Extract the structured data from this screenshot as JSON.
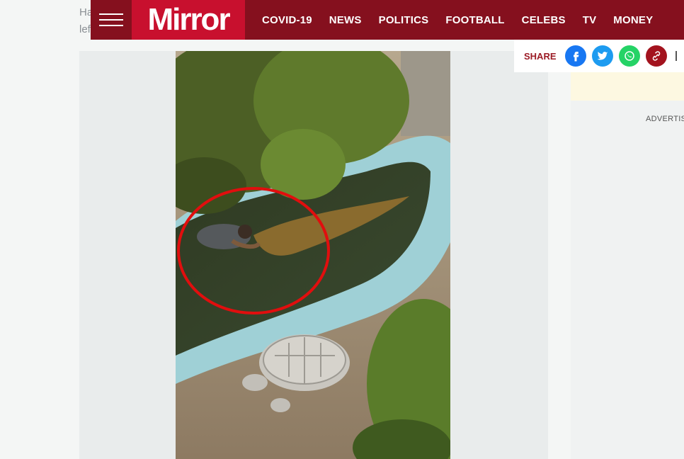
{
  "page": {
    "background_text_line1": "Ha",
    "background_text_line2": "lef"
  },
  "header": {
    "brand": "Mirror",
    "brand_color": "#c8102e",
    "nav_color": "#85101e",
    "nav": [
      "COVID-19",
      "NEWS",
      "POLITICS",
      "FOOTBALL",
      "CELEBS",
      "TV",
      "MONEY"
    ]
  },
  "share": {
    "label": "SHARE",
    "icons": [
      "facebook-icon",
      "twitter-icon",
      "whatsapp-icon",
      "link-icon"
    ]
  },
  "sidebar": {
    "advert_label": "ADVERTISE"
  },
  "media": {
    "annotation": "red circle highlighting man next to crocodile in pond"
  }
}
